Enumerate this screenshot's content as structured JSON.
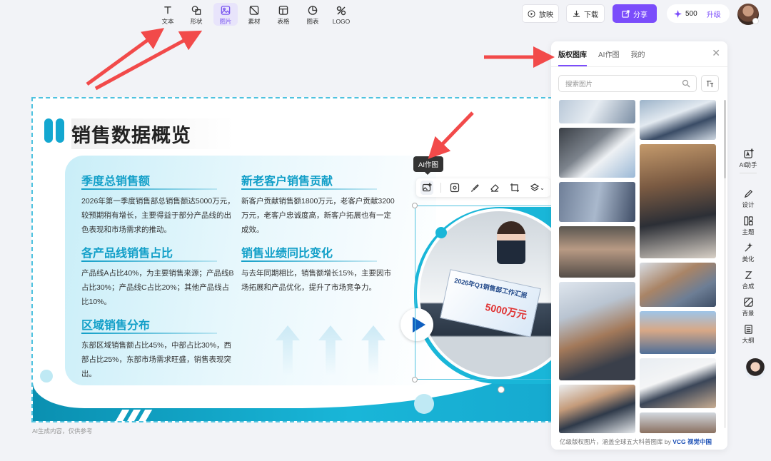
{
  "toolbar": {
    "tools": [
      {
        "label": "文本",
        "icon": "text-icon"
      },
      {
        "label": "形状",
        "icon": "shape-icon"
      },
      {
        "label": "图片",
        "icon": "image-icon"
      },
      {
        "label": "素材",
        "icon": "material-icon"
      },
      {
        "label": "表格",
        "icon": "table-icon"
      },
      {
        "label": "图表",
        "icon": "chart-icon"
      },
      {
        "label": "LOGO",
        "icon": "logo-icon"
      }
    ],
    "present_label": "放映",
    "download_label": "下载",
    "share_label": "分享",
    "credits": "500",
    "upgrade_label": "升级"
  },
  "slide": {
    "title": "销售数据概览",
    "sections": [
      {
        "heading": "季度总销售额",
        "body": "2026年第一季度销售部总销售额达5000万元，较预期稍有增长，主要得益于部分产品线的出色表现和市场需求的推动。"
      },
      {
        "heading": "各产品线销售占比",
        "body": "产品线A占比40%，为主要销售来源；产品线B占比30%；产品线C占比20%；其他产品线占比10%。"
      },
      {
        "heading": "区域销售分布",
        "body": "东部区域销售额占比45%，中部占比30%，西部占比25%，东部市场需求旺盛，销售表现突出。"
      },
      {
        "heading": "新老客户销售贡献",
        "body": "新客户贡献销售额1800万元，老客户贡献3200万元，老客户忠诚度高，新客户拓展也有一定成效。"
      },
      {
        "heading": "销售业绩同比变化",
        "body": "与去年同期相比，销售额增长15%，主要因市场拓展和产品优化，提升了市场竞争力。"
      }
    ],
    "photo_caption": "2026年Q1销售部工作汇报",
    "photo_amount": "5000万元"
  },
  "image_toolbar": {
    "tooltip": "AI作图"
  },
  "footnote": "AI生成内容，仅供参考",
  "panel": {
    "tabs": [
      "版权图库",
      "AI作图",
      "我的"
    ],
    "active_tab": "版权图库",
    "search_placeholder": "搜索图片",
    "footer_text": "亿级版权图片，涵盖全球五大科普图库 by",
    "footer_brand": "VCG 视觉中国"
  },
  "sidebar": {
    "items": [
      {
        "label": "AI助手",
        "icon": "ai-assistant-icon"
      },
      {
        "label": "设计",
        "icon": "design-icon"
      },
      {
        "label": "主题",
        "icon": "theme-icon"
      },
      {
        "label": "美化",
        "icon": "beautify-icon"
      },
      {
        "label": "合成",
        "icon": "compose-icon"
      },
      {
        "label": "背景",
        "icon": "background-icon"
      },
      {
        "label": "大纲",
        "icon": "outline-icon"
      }
    ]
  },
  "colors": {
    "accent": "#7b4dfb",
    "slide_primary": "#129fc8",
    "annotation_red": "#f24a4a"
  }
}
